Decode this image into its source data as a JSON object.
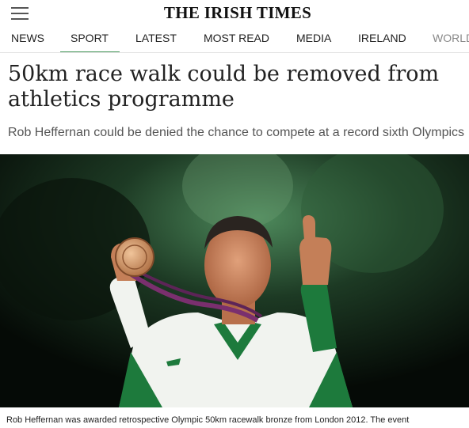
{
  "header": {
    "menu_icon": "hamburger-menu-icon",
    "masthead": "THE IRISH TIMES"
  },
  "nav": {
    "items": [
      {
        "label": "NEWS",
        "active": false
      },
      {
        "label": "SPORT",
        "active": true
      },
      {
        "label": "LATEST",
        "active": false
      },
      {
        "label": "MOST READ",
        "active": false
      },
      {
        "label": "MEDIA",
        "active": false
      },
      {
        "label": "IRELAND",
        "active": false
      },
      {
        "label": "WORLD",
        "active": false
      }
    ],
    "active_color": "#4a9a5e"
  },
  "article": {
    "headline": "50km race walk could be removed from athletics programme",
    "standfirst": "Rob Heffernan could be denied the chance to compete at a record sixth Olympics",
    "caption": "Rob Heffernan was awarded retrospective Olympic 50km racewalk bronze from London 2012. The event"
  }
}
